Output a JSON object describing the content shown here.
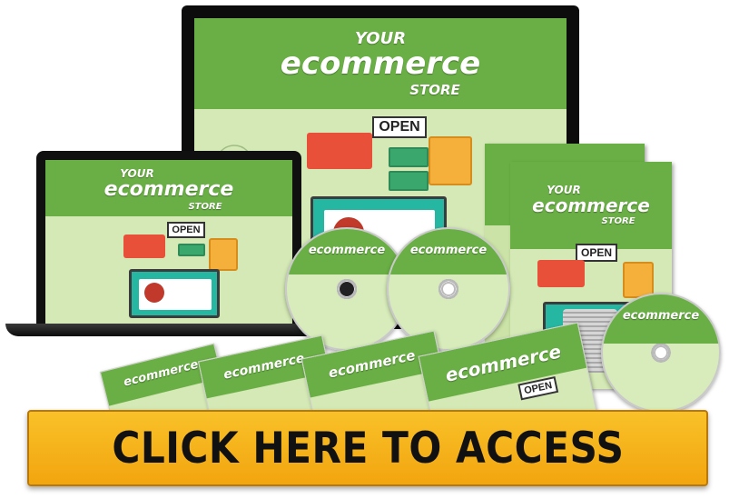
{
  "product": {
    "brand": {
      "line1": "YOUR",
      "line2": "ecommerce",
      "line3": "STORE"
    },
    "open_sign": "OPEN"
  },
  "cta": {
    "label": "CLICK HERE TO ACCESS"
  },
  "colors": {
    "band_green": "#6aaf45",
    "cover_light_green": "#d4e9b5",
    "cta_orange": "#f5b31a",
    "cta_text": "#111111",
    "screen_teal": "#26b7a3",
    "accent_red": "#e8503a"
  }
}
